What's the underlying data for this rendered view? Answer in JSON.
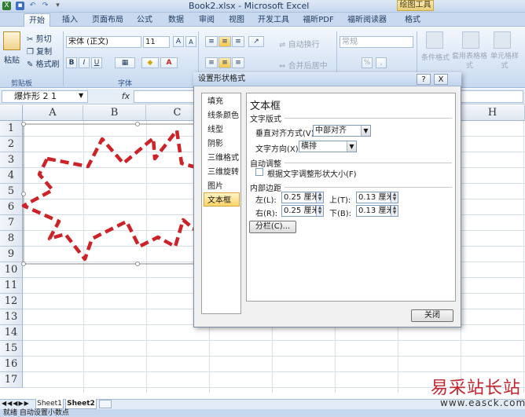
{
  "titlebar": {
    "title": "Book2.xlsx - Microsoft Excel",
    "context_tab": "绘图工具"
  },
  "ribbon_tabs": [
    "开始",
    "插入",
    "页面布局",
    "公式",
    "数据",
    "审阅",
    "视图",
    "开发工具",
    "福昕PDF",
    "福昕阅读器",
    "格式"
  ],
  "active_tab": "开始",
  "clipboard": {
    "paste": "粘贴",
    "cut": "剪切",
    "copy": "复制",
    "format_painter": "格式刷",
    "label": "剪贴板"
  },
  "font": {
    "name": "宋体 (正文)",
    "size": "11",
    "label": "字体",
    "bold": "B",
    "italic": "I",
    "underline": "U",
    "grow": "A",
    "shrink": "A"
  },
  "alignment": {
    "wrap": "自动换行",
    "merge": "合并后居中"
  },
  "number": {
    "format": "常规",
    "percent": "%",
    "comma": ","
  },
  "styles": {
    "conditional": "条件格式",
    "table": "套用表格格式",
    "cell": "单元格样式"
  },
  "formula_bar": {
    "name_box": "爆炸形 2 1",
    "fx": "fx"
  },
  "columns": [
    "A",
    "B",
    "C",
    "H"
  ],
  "rows": [
    "1",
    "2",
    "3",
    "4",
    "5",
    "6",
    "7",
    "8",
    "9",
    "10",
    "11",
    "12",
    "13",
    "14",
    "15",
    "16",
    "17"
  ],
  "sheet_tabs": [
    "Sheet1",
    "Sheet2"
  ],
  "status_text": "就绪  自动设置小数点",
  "dialog": {
    "title": "设置形状格式",
    "help_btn": "?",
    "close_btn": "X",
    "categories": [
      "填充",
      "线条颜色",
      "线型",
      "阴影",
      "三维格式",
      "三维旋转",
      "图片",
      "文本框"
    ],
    "selected_category": "文本框",
    "panel_title": "文本框",
    "layout_section": "文字版式",
    "valign_label": "垂直对齐方式(V):",
    "valign_value": "中部对齐",
    "direction_label": "文字方向(X):",
    "direction_value": "横排",
    "autofit_section": "自动调整",
    "autofit_checkbox": "根据文字调整形状大小(F)",
    "autofit_checked": false,
    "margin_section": "内部边距",
    "left_label": "左(L):",
    "left_value": "0.25 厘米",
    "right_label": "右(R):",
    "right_value": "0.25 厘米",
    "top_label": "上(T):",
    "top_value": "0.13 厘米",
    "bottom_label": "下(B):",
    "bottom_value": "0.13 厘米",
    "columns_btn": "分栏(C)...",
    "close": "关闭"
  },
  "watermark": {
    "text": "易采站长站",
    "url": "www.easck.com"
  },
  "colors": {
    "shape_dash": "#cc2228",
    "accent": "#c9daf0"
  }
}
